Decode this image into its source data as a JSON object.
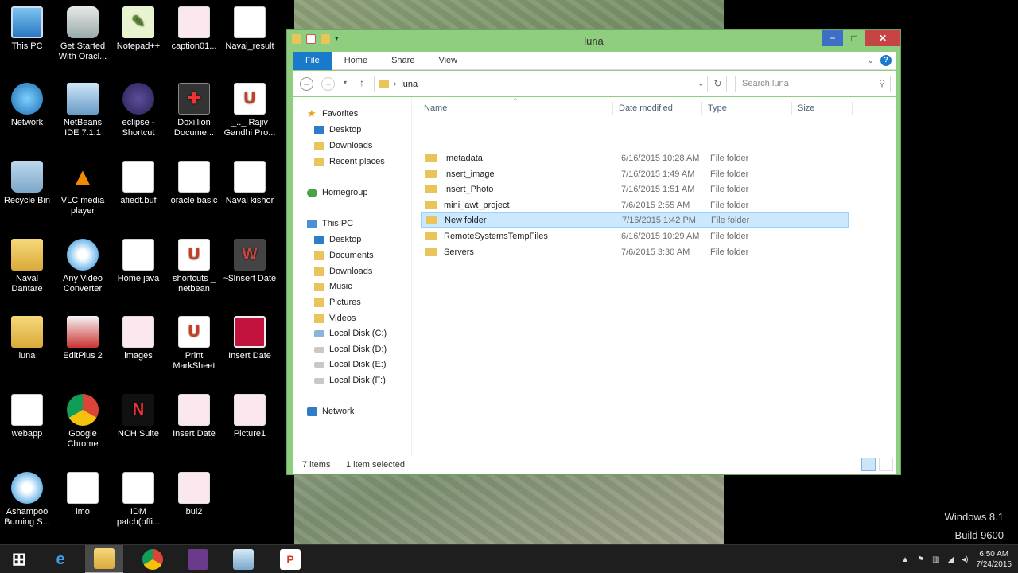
{
  "desktop": {
    "icons": [
      {
        "label": "This PC",
        "glyph": "▭"
      },
      {
        "label": "Get Started With Oracl...",
        "glyph": "◎"
      },
      {
        "label": "Notepad++",
        "glyph": "✎"
      },
      {
        "label": "caption01...",
        "glyph": "▤"
      },
      {
        "label": "Naval_result",
        "glyph": "▤"
      },
      {
        "label": "Network",
        "glyph": "◍"
      },
      {
        "label": "NetBeans IDE 7.1.1",
        "glyph": "◆"
      },
      {
        "label": "eclipse - Shortcut",
        "glyph": "◐"
      },
      {
        "label": "Doxillion Docume...",
        "glyph": "✚"
      },
      {
        "label": "_.._ Rajiv Gandhi Pro...",
        "glyph": "U"
      },
      {
        "label": "Recycle Bin",
        "glyph": "♻"
      },
      {
        "label": "VLC media player",
        "glyph": "▲"
      },
      {
        "label": "afiedt.buf",
        "glyph": ""
      },
      {
        "label": "oracle basic",
        "glyph": ""
      },
      {
        "label": "Naval kishor",
        "glyph": "▤"
      },
      {
        "label": "Naval Dantare",
        "glyph": "▰"
      },
      {
        "label": "Any Video Converter",
        "glyph": "◉"
      },
      {
        "label": "Home.java",
        "glyph": ""
      },
      {
        "label": "shortcuts _ netbean",
        "glyph": "U"
      },
      {
        "label": "~$Insert Date",
        "glyph": "W"
      },
      {
        "label": "luna",
        "glyph": "▰"
      },
      {
        "label": "EditPlus 2",
        "glyph": "✎"
      },
      {
        "label": "images",
        "glyph": "▤"
      },
      {
        "label": "Print MarkSheet",
        "glyph": "U"
      },
      {
        "label": "Insert Date",
        "glyph": "▣"
      },
      {
        "label": "webapp",
        "glyph": ""
      },
      {
        "label": "Google Chrome",
        "glyph": ""
      },
      {
        "label": "NCH Suite",
        "glyph": "N"
      },
      {
        "label": "Insert Date",
        "glyph": "▤"
      },
      {
        "label": "Picture1",
        "glyph": "▤"
      },
      {
        "label": "Ashampoo Burning S...",
        "glyph": "◎"
      },
      {
        "label": "imo",
        "glyph": ""
      },
      {
        "label": "IDM patch(offi...",
        "glyph": ""
      },
      {
        "label": "bul2",
        "glyph": "▤"
      }
    ]
  },
  "window": {
    "title": "luna",
    "controls": {
      "minimize": "−",
      "maximize": "□",
      "close": "✕"
    },
    "ribbon_tabs": [
      "File",
      "Home",
      "Share",
      "View"
    ],
    "address": {
      "path": "luna",
      "separator": "›"
    },
    "search_placeholder": "Search luna",
    "nav": {
      "favorites": "Favorites",
      "favorites_items": [
        "Desktop",
        "Downloads",
        "Recent places"
      ],
      "homegroup": "Homegroup",
      "this_pc": "This PC",
      "this_pc_items": [
        "Desktop",
        "Documents",
        "Downloads",
        "Music",
        "Pictures",
        "Videos",
        "Local Disk (C:)",
        "Local Disk (D:)",
        "Local Disk (E:)",
        "Local Disk (F:)"
      ],
      "network": "Network"
    },
    "columns": [
      "Name",
      "Date modified",
      "Type",
      "Size"
    ],
    "files": [
      {
        "name": ".metadata",
        "date": "6/16/2015 10:28 AM",
        "type": "File folder"
      },
      {
        "name": "Insert_image",
        "date": "7/16/2015 1:49 AM",
        "type": "File folder"
      },
      {
        "name": "Insert_Photo",
        "date": "7/16/2015 1:51 AM",
        "type": "File folder"
      },
      {
        "name": "mini_awt_project",
        "date": "7/6/2015 2:55 AM",
        "type": "File folder"
      },
      {
        "name": "New folder",
        "date": "7/16/2015 1:42 PM",
        "type": "File folder",
        "selected": true
      },
      {
        "name": "RemoteSystemsTempFiles",
        "date": "6/16/2015 10:29 AM",
        "type": "File folder"
      },
      {
        "name": "Servers",
        "date": "7/6/2015 3:30 AM",
        "type": "File folder"
      }
    ],
    "status": {
      "count": "7 items",
      "selection": "1 item selected"
    }
  },
  "watermark": {
    "line1": "Windows 8.1",
    "line2": "Build 9600"
  },
  "taskbar": {
    "start_glyph": "⊞",
    "clock_time": "6:50 AM",
    "clock_date": "7/24/2015",
    "tray_icons": [
      "▲",
      "⚑",
      "▥",
      "◢",
      "◂)"
    ]
  },
  "colors": {
    "window_frame": "#8fce7f",
    "file_tab": "#1979ca",
    "selection": "#cce8ff",
    "close": "#c74444"
  }
}
